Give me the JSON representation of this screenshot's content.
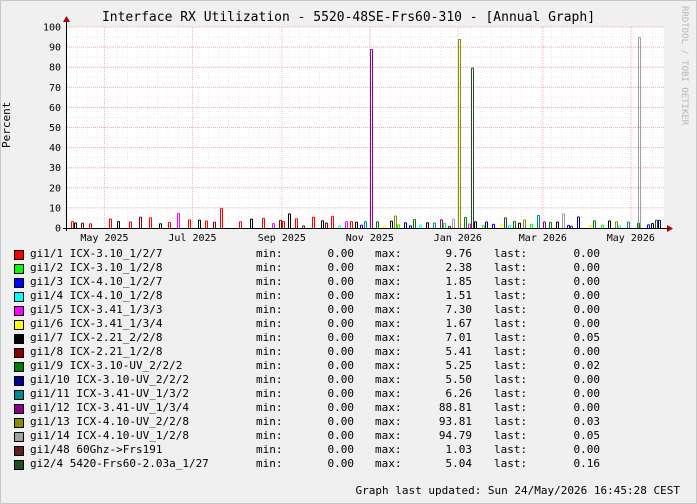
{
  "title": "Interface RX Utilization - 5520-48SE-Frs60-310 - [Annual Graph]",
  "watermark": "RRDTOOL / TOBI OETIKER",
  "footer": "Graph last updated: Sun 24/May/2026 16:45:28 CEST",
  "colors": {
    "background": "#F0F0F0",
    "plot_background": "#FFFFFF",
    "grid_minor": "#E6E6E6",
    "grid_major": "#F0B4B4",
    "axis": "#000000",
    "arrow": "#B00000"
  },
  "legend_labels": {
    "min": "min:",
    "max": "max:",
    "last": "last:"
  },
  "chart_data": {
    "type": "bar",
    "ylabel": "Percent",
    "ylim": [
      0,
      100
    ],
    "yticks": [
      0,
      10,
      20,
      30,
      40,
      50,
      60,
      70,
      80,
      90,
      100
    ],
    "xlim": [
      "2025-04-05",
      "2026-05-24"
    ],
    "xticks": [
      {
        "date": "2025-05-01",
        "label": "May 2025"
      },
      {
        "date": "2025-07-01",
        "label": "Jul 2025"
      },
      {
        "date": "2025-09-01",
        "label": "Sep 2025"
      },
      {
        "date": "2025-11-01",
        "label": "Nov 2025"
      },
      {
        "date": "2026-01-01",
        "label": "Jan 2026"
      },
      {
        "date": "2026-03-01",
        "label": "Mar 2026"
      },
      {
        "date": "2026-05-01",
        "label": "May 2026"
      }
    ],
    "grid": true,
    "legend_position": "bottom",
    "series": [
      {
        "name": "gi1/1 ICX-3.10_1/2/7",
        "color": "#FF0000",
        "min": "0.00",
        "max": "9.76",
        "last": "0.00",
        "points": [
          [
            "2025-04-08",
            3.2
          ],
          [
            "2025-04-20",
            2.1
          ],
          [
            "2025-05-04",
            4.5
          ],
          [
            "2025-05-18",
            3.0
          ],
          [
            "2025-06-01",
            5.1
          ],
          [
            "2025-06-14",
            2.8
          ],
          [
            "2025-06-28",
            4.0
          ],
          [
            "2025-07-10",
            3.5
          ],
          [
            "2025-07-20",
            9.76
          ],
          [
            "2025-08-02",
            3.1
          ],
          [
            "2025-08-18",
            4.8
          ],
          [
            "2025-09-01",
            3.3
          ],
          [
            "2025-09-10",
            4.6
          ],
          [
            "2025-09-22",
            5.4
          ],
          [
            "2025-10-05",
            5.8
          ],
          [
            "2025-10-18",
            3.2
          ]
        ]
      },
      {
        "name": "gi1/2 ICX-3.10_1/2/8",
        "color": "#00FF00",
        "min": "0.00",
        "max": "2.38",
        "last": "0.00",
        "points": [
          [
            "2025-11-20",
            1.6
          ],
          [
            "2025-12-22",
            2.38
          ],
          [
            "2026-01-18",
            1.2
          ],
          [
            "2026-02-20",
            1.9
          ],
          [
            "2026-04-10",
            1.4
          ]
        ]
      },
      {
        "name": "gi1/3 ICX-4.10_1/2/7",
        "color": "#0000FF",
        "min": "0.00",
        "max": "1.85",
        "last": "0.00",
        "points": [
          [
            "2025-10-25",
            1.4
          ],
          [
            "2025-11-28",
            1.1
          ],
          [
            "2026-01-25",
            1.85
          ],
          [
            "2026-03-18",
            1.3
          ],
          [
            "2026-05-12",
            1.6
          ]
        ]
      },
      {
        "name": "gi1/4 ICX-4.10_1/2/8",
        "color": "#00FFFF",
        "min": "0.00",
        "max": "1.51",
        "last": "0.00",
        "points": [
          [
            "2025-10-10",
            1.1
          ],
          [
            "2025-12-05",
            1.51
          ],
          [
            "2026-02-05",
            1.2
          ],
          [
            "2026-04-22",
            1.0
          ]
        ]
      },
      {
        "name": "gi1/5 ICX-3.41_1/3/3",
        "color": "#FF00FF",
        "min": "0.00",
        "max": "7.30",
        "last": "0.00",
        "points": [
          [
            "2025-06-20",
            7.3
          ],
          [
            "2025-08-25",
            2.2
          ],
          [
            "2025-10-15",
            3.1
          ],
          [
            "2026-01-08",
            2.0
          ]
        ]
      },
      {
        "name": "gi1/6 ICX-3.41_1/3/4",
        "color": "#FFFF00",
        "min": "0.00",
        "max": "1.67",
        "last": "0.00",
        "points": [
          [
            "2025-11-10",
            1.2
          ],
          [
            "2026-01-30",
            1.67
          ],
          [
            "2026-04-02",
            1.1
          ]
        ]
      },
      {
        "name": "gi1/7 ICX-2.21_2/2/8",
        "color": "#000000",
        "min": "0.00",
        "max": "7.01",
        "last": "0.05",
        "points": [
          [
            "2025-04-10",
            2.5
          ],
          [
            "2025-05-10",
            3.2
          ],
          [
            "2025-06-08",
            2.1
          ],
          [
            "2025-07-05",
            3.9
          ],
          [
            "2025-08-10",
            4.4
          ],
          [
            "2025-09-05",
            7.01
          ],
          [
            "2025-09-28",
            3.6
          ],
          [
            "2025-10-22",
            2.9
          ],
          [
            "2025-11-15",
            3.4
          ],
          [
            "2025-12-10",
            2.6
          ],
          [
            "2026-01-12",
            3.1
          ],
          [
            "2026-02-12",
            2.4
          ],
          [
            "2026-03-10",
            2.9
          ],
          [
            "2026-04-15",
            3.5
          ],
          [
            "2026-05-15",
            2.2
          ]
        ]
      },
      {
        "name": "gi1/8 ICX-2.21_1/2/8",
        "color": "#8B0000",
        "min": "0.00",
        "max": "5.41",
        "last": "0.00",
        "points": [
          [
            "2025-04-15",
            2.4
          ],
          [
            "2025-05-25",
            5.41
          ],
          [
            "2025-07-15",
            2.9
          ],
          [
            "2025-08-30",
            3.8
          ],
          [
            "2025-10-01",
            2.5
          ]
        ]
      },
      {
        "name": "gi1/9 ICX-3.10-UV_2/2/2",
        "color": "#008000",
        "min": "0.00",
        "max": "5.25",
        "last": "0.02",
        "points": [
          [
            "2025-11-05",
            3.1
          ],
          [
            "2025-12-01",
            4.2
          ],
          [
            "2026-01-05",
            5.25
          ],
          [
            "2026-02-08",
            3.3
          ],
          [
            "2026-03-05",
            2.8
          ],
          [
            "2026-04-05",
            3.6
          ],
          [
            "2026-05-05",
            2.4
          ]
        ]
      },
      {
        "name": "gi1/10 ICX-3.10-UV_2/2/2",
        "color": "#00008B",
        "min": "0.00",
        "max": "5.50",
        "last": "0.00",
        "points": [
          [
            "2025-11-25",
            2.6
          ],
          [
            "2026-01-20",
            3.0
          ],
          [
            "2026-03-25",
            5.5
          ],
          [
            "2026-05-20",
            3.8
          ]
        ]
      },
      {
        "name": "gi1/11 ICX-3.41-UV_1/3/2",
        "color": "#008B8B",
        "min": "0.00",
        "max": "6.26",
        "last": "0.00",
        "points": [
          [
            "2025-10-28",
            3.2
          ],
          [
            "2025-12-15",
            2.5
          ],
          [
            "2026-02-25",
            6.26
          ],
          [
            "2026-04-28",
            2.9
          ]
        ]
      },
      {
        "name": "gi1/12 ICX-3.41-UV_1/3/4",
        "color": "#8B008B",
        "min": "0.00",
        "max": "88.81",
        "last": "0.00",
        "points": [
          [
            "2025-11-01",
            88.81
          ],
          [
            "2025-12-20",
            4.1
          ],
          [
            "2026-03-01",
            3.0
          ]
        ]
      },
      {
        "name": "gi1/13 ICX-4.10-UV_2/2/8",
        "color": "#8B8B00",
        "min": "0.00",
        "max": "93.81",
        "last": "0.03",
        "points": [
          [
            "2025-11-18",
            6.0
          ],
          [
            "2026-01-01",
            93.81
          ],
          [
            "2026-02-15",
            4.0
          ],
          [
            "2026-04-20",
            3.1
          ]
        ]
      },
      {
        "name": "gi1/14 ICX-4.10-UV_1/2/8",
        "color": "#A0A0A0",
        "min": "0.00",
        "max": "94.79",
        "last": "0.05",
        "points": [
          [
            "2025-12-28",
            4.4
          ],
          [
            "2026-03-14",
            7.0
          ],
          [
            "2026-05-06",
            94.79
          ]
        ]
      },
      {
        "name": "gi1/48 60Ghz->Frs191",
        "color": "#602020",
        "min": "0.00",
        "max": "1.03",
        "last": "0.00",
        "points": [
          [
            "2025-09-15",
            1.03
          ],
          [
            "2025-12-25",
            0.8
          ],
          [
            "2026-03-20",
            0.9
          ]
        ]
      },
      {
        "name": "gi2/4 5420-Frs60-2.03a_1/27",
        "color": "#205020",
        "min": "0.00",
        "max": "5.04",
        "last": "0.16",
        "points": [
          [
            "2026-01-10",
            79.5
          ],
          [
            "2026-02-02",
            5.04
          ],
          [
            "2026-05-18",
            3.9
          ]
        ]
      }
    ]
  }
}
